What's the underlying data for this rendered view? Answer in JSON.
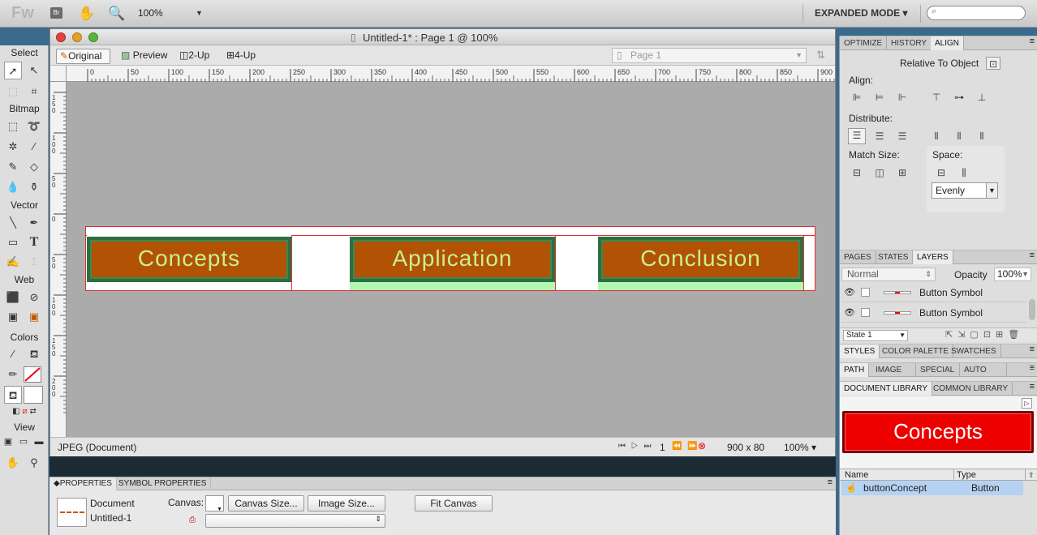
{
  "app": {
    "logo": "Fw",
    "br_badge": "Br",
    "zoom": "100%",
    "mode": "EXPANDED MODE ▾",
    "search_placeholder": ""
  },
  "tools": {
    "select": "Select",
    "bitmap": "Bitmap",
    "vector": "Vector",
    "web": "Web",
    "colors": "Colors",
    "view": "View"
  },
  "document": {
    "title": "Untitled-1* : Page 1 @ 100%",
    "tabs": [
      "Original",
      "Preview",
      "2-Up",
      "4-Up"
    ],
    "page_select": "Page 1",
    "ruler_h": [
      "0",
      "50",
      "100",
      "150",
      "200",
      "250",
      "300",
      "350",
      "400",
      "450",
      "500",
      "550",
      "600",
      "650",
      "700",
      "750",
      "800",
      "850",
      "900"
    ],
    "ruler_v": [
      "1\n5\n0",
      "1\n0\n0",
      "5\n0",
      "0",
      "5\n0",
      "1\n0\n0",
      "1\n5\n0",
      "2\n0\n0"
    ],
    "buttons": [
      "Concepts",
      "Application",
      "Conclusion"
    ],
    "status_format": "JPEG (Document)",
    "frame": "1",
    "size": "900 x 80",
    "zoom": "100% ▾"
  },
  "properties": {
    "tabs": [
      "PROPERTIES",
      "SYMBOL PROPERTIES"
    ],
    "doc_label": "Document",
    "doc_name": "Untitled-1",
    "canvas_label": "Canvas:",
    "canvas_size": "Canvas Size...",
    "image_size": "Image Size...",
    "fit_canvas": "Fit Canvas"
  },
  "align_panel": {
    "tabs": [
      "OPTIMIZE",
      "HISTORY",
      "ALIGN"
    ],
    "relative": "Relative To Object",
    "align": "Align:",
    "distribute": "Distribute:",
    "match_size": "Match Size:",
    "space": "Space:",
    "space_value": "Evenly"
  },
  "layers_panel": {
    "tabs": [
      "PAGES",
      "STATES",
      "LAYERS"
    ],
    "blend": "Normal",
    "opacity_label": "Opacity",
    "opacity": "100%",
    "layers": [
      "Button Symbol",
      "Button Symbol"
    ],
    "state": "State 1"
  },
  "styles_panel": {
    "tabs": [
      "STYLES",
      "COLOR PALETTE",
      "SWATCHES"
    ]
  },
  "path_panel": {
    "tabs": [
      "PATH",
      "IMAGE EDI",
      "SPECIAL C",
      "AUTO SHA"
    ]
  },
  "library": {
    "tabs": [
      "DOCUMENT LIBRARY",
      "COMMON LIBRARY"
    ],
    "preview": "Concepts",
    "col_name": "Name",
    "col_type": "Type",
    "items": [
      {
        "name": "buttonConcept",
        "type": "Button"
      }
    ]
  },
  "colors": {
    "button_fill": "#b25204",
    "button_border": "#2e6e40",
    "button_text": "#c8f090",
    "lib_button": "#ee0000",
    "selection": "#b6d2f2"
  }
}
